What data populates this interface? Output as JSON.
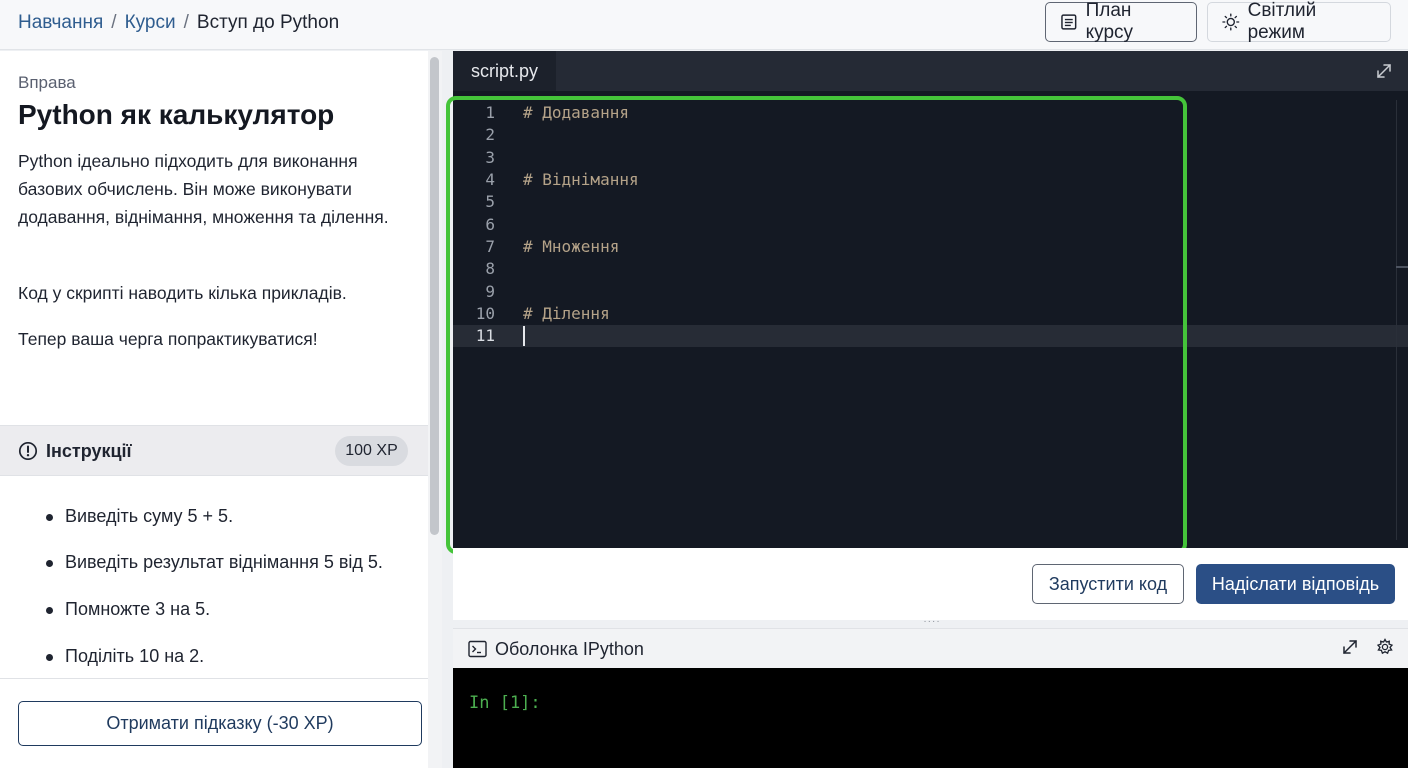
{
  "breadcrumb": {
    "items": [
      "Навчання",
      "Курси"
    ],
    "current": "Вступ до Python",
    "separator": "/"
  },
  "header": {
    "plan_label": "План курсу",
    "theme_label": "Світлий режим"
  },
  "exercise": {
    "label": "Вправа",
    "title": "Python як калькулятор",
    "paragraphs": [
      "Python ідеально підходить для виконання базових обчислень. Він може виконувати додавання, віднімання, множення та ділення.",
      "Код у скрипті наводить кілька прикладів.",
      "Тепер ваша черга попрактикуватися!"
    ]
  },
  "instructions": {
    "title": "Інструкції",
    "xp": "100 XP",
    "items": [
      "Виведіть суму 5 + 5.",
      "Виведіть результат віднімання 5 від 5.",
      "Помножте 3 на 5.",
      "Поділіть 10 на 2."
    ]
  },
  "hint": {
    "label": "Отримати підказку (-30 XP)"
  },
  "editor": {
    "tab": "script.py",
    "line_numbers": [
      "1",
      "2",
      "3",
      "4",
      "5",
      "6",
      "7",
      "8",
      "9",
      "10",
      "11"
    ],
    "active_line": 11,
    "lines": [
      "# Додавання",
      "",
      "",
      "# Віднімання",
      "",
      "",
      "# Множення",
      "",
      "",
      "# Ділення",
      ""
    ],
    "highlight_color": "#45c43a"
  },
  "actions": {
    "run_label": "Запустити код",
    "submit_label": "Надіслати відповідь"
  },
  "shell": {
    "title": "Оболонка IPython",
    "prompt": "In [1]:"
  },
  "colors": {
    "accent": "#2b4f86",
    "link": "#2f5d8f",
    "comment": "#b5a389",
    "prompt": "#4caf50"
  }
}
